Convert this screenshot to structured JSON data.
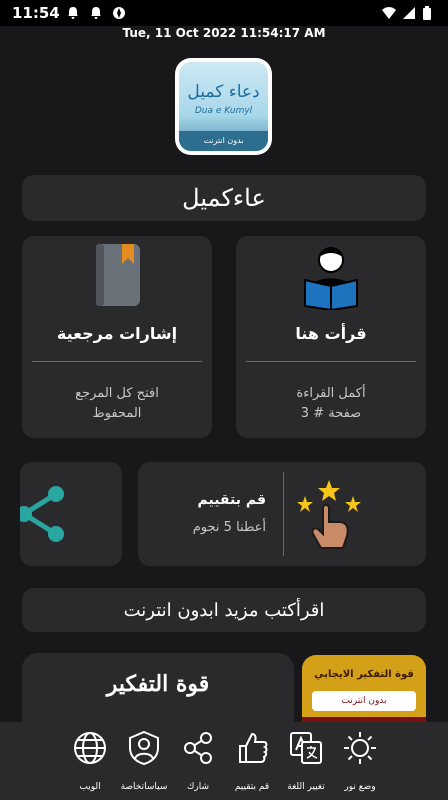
{
  "status_bar": {
    "time": "11:54",
    "icons": [
      "notification-bell-icon",
      "notification-bell-icon",
      "aperture-icon",
      "wifi-icon",
      "signal-icon",
      "battery-icon"
    ]
  },
  "datetime": "Tue, 11  Oct  2022   11:54:17 AM",
  "logo": {
    "arabic": "دعاء كميل",
    "latin": "Dua e Kumyl",
    "band": "بدون انترنت"
  },
  "app_title": "عاءكميل",
  "bookmarks_card": {
    "icon": "book-icon",
    "title": "إشارات مرجعية",
    "subtitle_line1": "افتح كل المرجع",
    "subtitle_line2": "المحفوظ"
  },
  "read_card": {
    "icon": "reader-icon",
    "title": "قرأت هنا",
    "subtitle_line1": "أكمل القراءة",
    "subtitle_line2": "صفحة # 3"
  },
  "share_card": {
    "icon": "share-icon"
  },
  "rate_card": {
    "icon": "rate-stars-icon",
    "title": "قم بتقييم",
    "subtitle": "أعطنا 5 نجوم"
  },
  "offline_more": "اقرأكتب مزيد ابدون انترنت",
  "power_card": {
    "title": "قوة التفكير"
  },
  "book_card": {
    "title": "قوة التفكير الايجابي",
    "subtitle": "بدون انترنت"
  },
  "bottom_nav": {
    "items": [
      {
        "icon": "globe-icon",
        "label": "الويب"
      },
      {
        "icon": "privacy-shield-icon",
        "label": "سياساتخاصة"
      },
      {
        "icon": "share-icon",
        "label": "شارك"
      },
      {
        "icon": "thumbs-up-icon",
        "label": "قم بتقييم"
      },
      {
        "icon": "translate-icon",
        "label": "تغيير اللغة"
      },
      {
        "icon": "sun-icon",
        "label": "وضع نور"
      }
    ]
  }
}
